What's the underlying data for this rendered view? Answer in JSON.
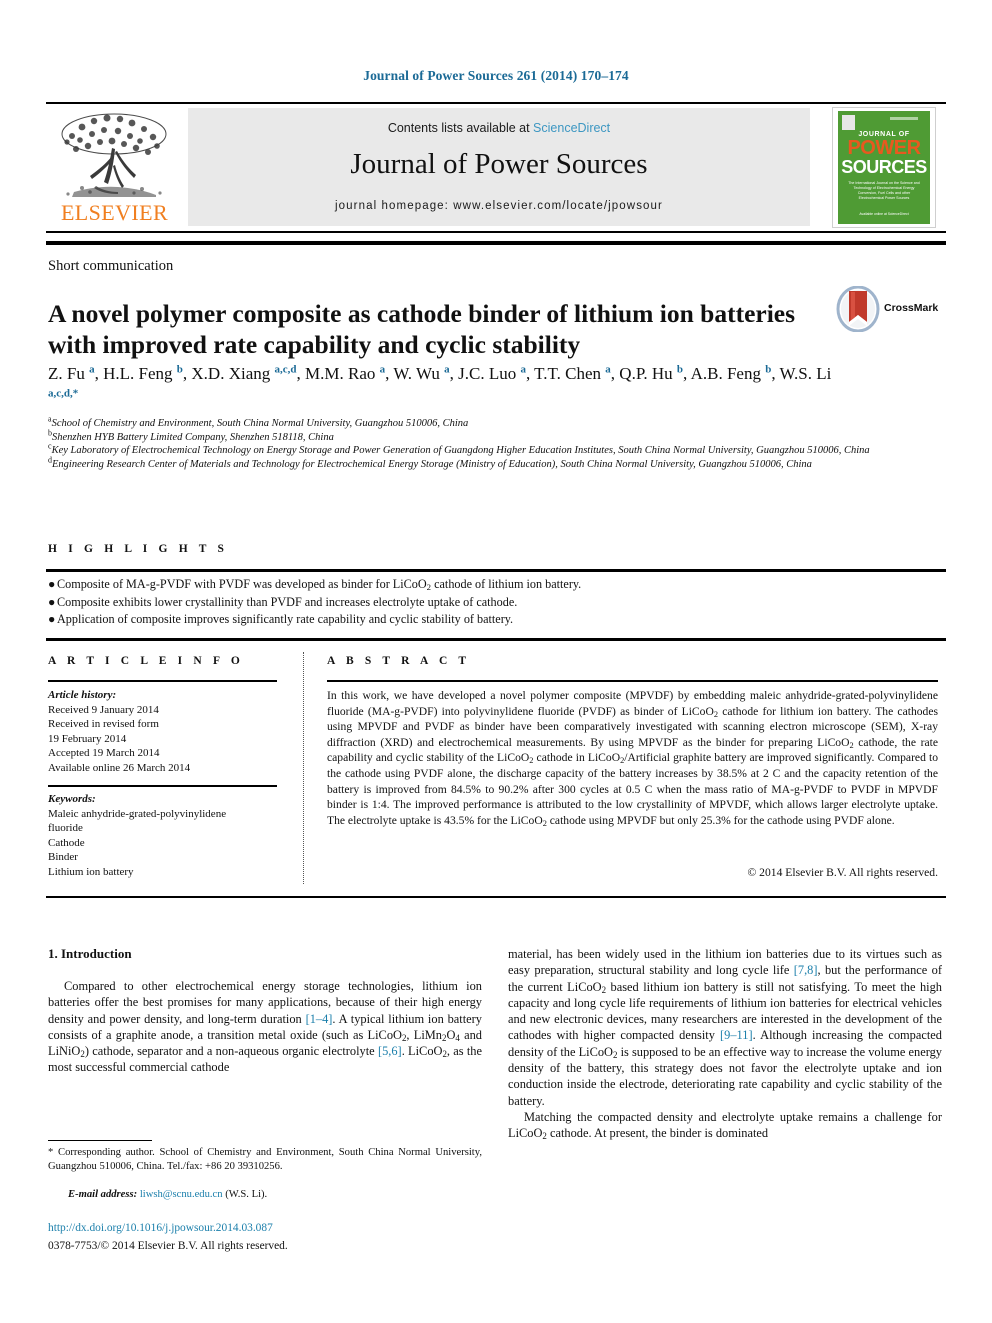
{
  "running_head": "Journal of Power Sources 261 (2014) 170–174",
  "masthead": {
    "contents_prefix": "Contents lists available at ",
    "sciencedirect": "ScienceDirect",
    "journal_title": "Journal of Power Sources",
    "homepage": "journal homepage: www.elsevier.com/locate/jpowsour",
    "elsevier_wordmark": "ELSEVIER",
    "cover": {
      "line_journal_of": "JOURNAL OF",
      "line_power": "POWER",
      "line_sources": "SOURCES",
      "subtitle": "The International Journal on the Science and Technology of Electrochemical Energy Conversion, Fuel Cells and other Electrochemical Power Sources",
      "footer": "Available online at ScienceDirect"
    },
    "colors": {
      "link_blue": "#3d97c2",
      "elsevier_orange": "#f07f20",
      "cover_green": "#4f9b34",
      "cover_orange": "#e8591f"
    }
  },
  "article": {
    "section_type": "Short communication",
    "title": "A novel polymer composite as cathode binder of lithium ion batteries with improved rate capability and cyclic stability",
    "crossmark_label": "CrossMark",
    "authors_html": "Z. Fu <sup>a</sup>, H.L. Feng <sup>b</sup>, X.D. Xiang <sup>a,c,d</sup>, M.M. Rao <sup>a</sup>, W. Wu <sup>a</sup>, J.C. Luo <sup>a</sup>, T.T. Chen <sup>a</sup>, Q.P. Hu <sup>b</sup>, A.B. Feng <sup>b</sup>, W.S. Li <sup>a,c,d,*</sup>",
    "affiliations": [
      {
        "mark": "a",
        "text": "School of Chemistry and Environment, South China Normal University, Guangzhou 510006, China"
      },
      {
        "mark": "b",
        "text": "Shenzhen HYB Battery Limited Company, Shenzhen 518118, China"
      },
      {
        "mark": "c",
        "text": "Key Laboratory of Electrochemical Technology on Energy Storage and Power Generation of Guangdong Higher Education Institutes, South China Normal University, Guangzhou 510006, China"
      },
      {
        "mark": "d",
        "text": "Engineering Research Center of Materials and Technology for Electrochemical Energy Storage (Ministry of Education), South China Normal University, Guangzhou 510006, China"
      }
    ]
  },
  "highlights": {
    "heading": "H I G H L I G H T S",
    "items_html": [
      "Composite of MA-g-PVDF with PVDF was developed as binder for LiCoO<sub>2</sub> cathode of lithium ion battery.",
      "Composite exhibits lower crystallinity than PVDF and increases electrolyte uptake of cathode.",
      "Application of composite improves significantly rate capability and cyclic stability of battery."
    ]
  },
  "article_info": {
    "heading": "A R T I C L E   I N F O",
    "history_label": "Article history:",
    "history": [
      "Received 9 January 2014",
      "Received in revised form",
      "19 February 2014",
      "Accepted 19 March 2014",
      "Available online 26 March 2014"
    ],
    "keywords_label": "Keywords:",
    "keywords": [
      "Maleic anhydride-grated-polyvinylidene",
      "fluoride",
      "Cathode",
      "Binder",
      "Lithium ion battery"
    ]
  },
  "abstract": {
    "heading": "A B S T R A C T",
    "body_html": "In this work, we have developed a novel polymer composite (MPVDF) by embedding maleic anhydride-grated-polyvinylidene fluoride (MA-g-PVDF) into polyvinylidene fluoride (PVDF) as binder of LiCoO<sub>2</sub> cathode for lithium ion battery. The cathodes using MPVDF and PVDF as binder have been comparatively investigated with scanning electron microscope (SEM), X-ray diffraction (XRD) and electrochemical measurements. By using MPVDF as the binder for preparing LiCoO<sub>2</sub> cathode, the rate capability and cyclic stability of the LiCoO<sub>2</sub> cathode in LiCoO<sub>2</sub>/Artificial graphite battery are improved significantly. Compared to the cathode using PVDF alone, the discharge capacity of the battery increases by 38.5% at 2 C and the capacity retention of the battery is improved from 84.5% to 90.2% after 300 cycles at 0.5 C when the mass ratio of MA-g-PVDF to PVDF in MPVDF binder is 1:4. The improved performance is attributed to the low crystallinity of MPVDF, which allows larger electrolyte uptake. The electrolyte uptake is 43.5% for the LiCoO<sub>2</sub> cathode using MPVDF but only 25.3% for the cathode using PVDF alone.",
    "copyright": "© 2014 Elsevier B.V. All rights reserved."
  },
  "body": {
    "section_heading": "1. Introduction",
    "left_paragraph_html": "Compared to other electrochemical energy storage technologies, lithium ion batteries offer the best promises for many applications, because of their high energy density and power density, and long-term duration <span class=\"ref\">[1–4]</span>. A typical lithium ion battery consists of a graphite anode, a transition metal oxide (such as LiCoO<sub>2</sub>, LiMn<sub>2</sub>O<sub>4</sub> and LiNiO<sub>2</sub>) cathode, separator and a non-aqueous organic electrolyte <span class=\"ref\">[5,6]</span>. LiCoO<sub>2</sub>, as the most successful commercial cathode",
    "right_paragraph1_html": "material, has been widely used in the lithium ion batteries due to its virtues such as easy preparation, structural stability and long cycle life <span class=\"ref\">[7,8]</span>, but the performance of the current LiCoO<sub>2</sub> based lithium ion battery is still not satisfying. To meet the high capacity and long cycle life requirements of lithium ion batteries for electrical vehicles and new electronic devices, many researchers are interested in the development of the cathodes with higher compacted density <span class=\"ref\">[9–11]</span>. Although increasing the compacted density of the LiCoO<sub>2</sub> is supposed to be an effective way to increase the volume energy density of the battery, this strategy does not favor the electrolyte uptake and ion conduction inside the electrode, deteriorating rate capability and cyclic stability of the battery.",
    "right_paragraph2_html": "Matching the compacted density and electrolyte uptake remains a challenge for LiCoO<sub>2</sub> cathode. At present, the binder is dominated"
  },
  "footer": {
    "corresponding_html": "<span class=\"star\">*</span> Corresponding author. School of Chemistry and Environment, South China Normal University, Guangzhou 510006, China. Tel./fax: +86 20 39310256.",
    "email_label": "E-mail address:",
    "email": "liwsh@scnu.edu.cn",
    "email_suffix": "(W.S. Li).",
    "doi": "http://dx.doi.org/10.1016/j.jpowsour.2014.03.087",
    "issn_line": "0378-7753/© 2014 Elsevier B.V. All rights reserved."
  }
}
